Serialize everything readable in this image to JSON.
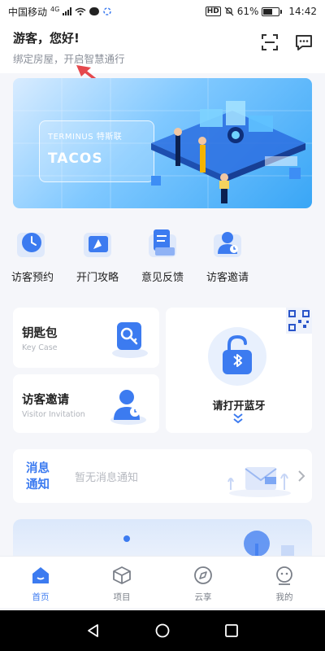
{
  "status": {
    "carrier": "中国移动",
    "net": "4G",
    "hd": "HD",
    "battery": "61%",
    "battery_level": 0.61,
    "time": "14:42"
  },
  "header": {
    "greeting": "游客，您好!",
    "subtitle": "绑定房屋，开启智慧通行",
    "icons": [
      "scan-icon",
      "message-icon"
    ]
  },
  "banner": {
    "brand_line": "TERMINUS 特斯联",
    "brand_main": "TACOS",
    "bg_color": "#39a6f6"
  },
  "quick_actions": [
    {
      "label": "访客预约",
      "icon": "clock-icon"
    },
    {
      "label": "开门攻略",
      "icon": "compass-icon"
    },
    {
      "label": "意见反馈",
      "icon": "feedback-icon"
    },
    {
      "label": "访客邀请",
      "icon": "visitor-icon"
    }
  ],
  "cards": {
    "keycase": {
      "title": "钥匙包",
      "subtitle": "Key Case",
      "icon": "key-icon"
    },
    "invite": {
      "title": "访客邀请",
      "subtitle": "Visitor Invitation",
      "icon": "visitor-icon"
    },
    "bluetooth": {
      "label": "请打开蓝牙",
      "icon": "bluetooth-lock-icon"
    }
  },
  "notice": {
    "title": "消息通知",
    "text": "暂无消息通知"
  },
  "tabs": [
    {
      "label": "首页",
      "icon": "home-icon",
      "active": true
    },
    {
      "label": "项目",
      "icon": "cube-icon",
      "active": false
    },
    {
      "label": "云享",
      "icon": "compass-icon",
      "active": false
    },
    {
      "label": "我的",
      "icon": "profile-icon",
      "active": false
    }
  ],
  "colors": {
    "accent": "#3c7bf0",
    "annotation_arrow": "#e5484d"
  }
}
